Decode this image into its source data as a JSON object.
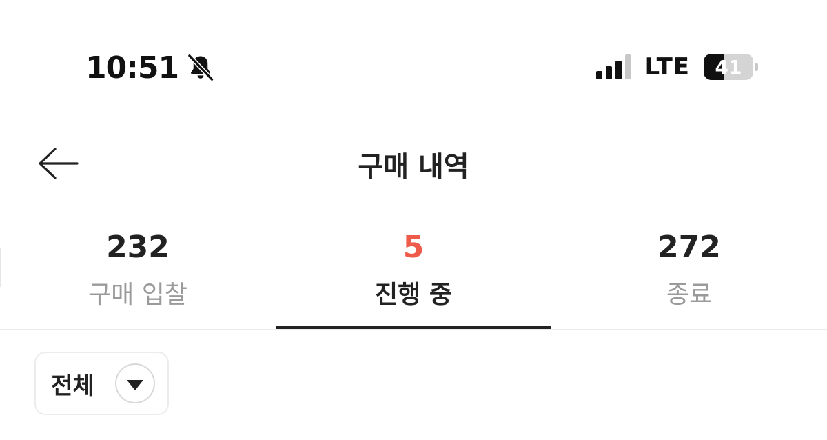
{
  "status_bar": {
    "time": "10:51",
    "mute_icon": "bell-slash-icon",
    "network": "LTE",
    "signal_bars_active": 3,
    "signal_bars_total": 4,
    "battery_level": "41",
    "battery_fraction": 0.41
  },
  "header": {
    "title": "구매 내역",
    "back_icon": "arrow-left-icon"
  },
  "tabs": [
    {
      "count": "232",
      "label": "구매 입찰",
      "active": false
    },
    {
      "count": "5",
      "label": "진행 중",
      "active": true
    },
    {
      "count": "272",
      "label": "종료",
      "active": false
    }
  ],
  "filter": {
    "label": "전체",
    "icon": "caret-down-icon"
  },
  "colors": {
    "accent": "#ef5b4a",
    "text_primary": "#222222",
    "text_secondary": "#9a9a9a",
    "indicator": "#222222"
  }
}
